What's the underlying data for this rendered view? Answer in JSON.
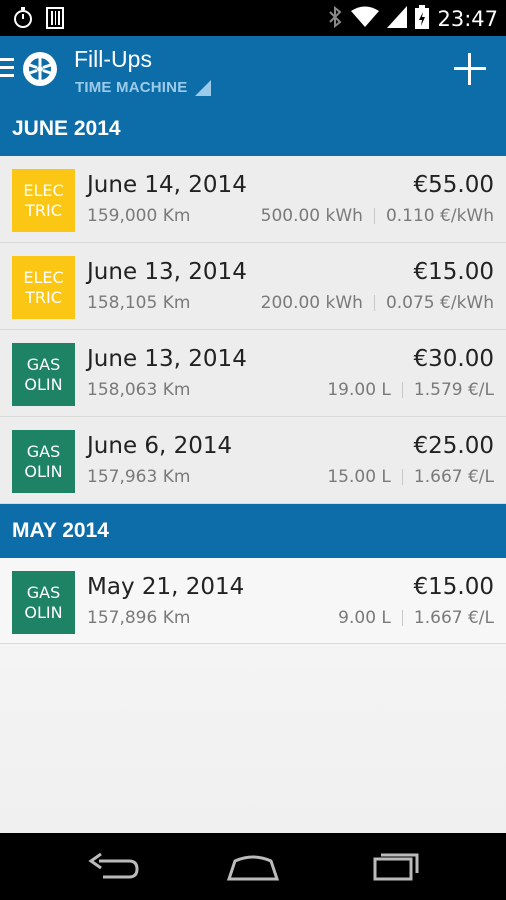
{
  "status_bar": {
    "time": "23:47",
    "left_icons": [
      "stopwatch-icon",
      "barcode-icon"
    ],
    "right_icons": [
      "bluetooth-icon",
      "wifi-icon",
      "signal-icon",
      "battery-icon"
    ]
  },
  "action_bar": {
    "title": "Fill-Ups",
    "subtitle": "TIME MACHINE",
    "color": "#0d6da8"
  },
  "sections": [
    {
      "header": "JUNE 2014",
      "items": [
        {
          "type_label": [
            "ELEC",
            "TRIC"
          ],
          "type": "electric",
          "date": "June 14, 2014",
          "odometer": "159,000 Km",
          "price": "€55.00",
          "quantity": "500.00 kWh",
          "unit_price": "0.110 €/kWh"
        },
        {
          "type_label": [
            "ELEC",
            "TRIC"
          ],
          "type": "electric",
          "date": "June 13, 2014",
          "odometer": "158,105 Km",
          "price": "€15.00",
          "quantity": "200.00 kWh",
          "unit_price": "0.075 €/kWh"
        },
        {
          "type_label": [
            "GAS",
            "OLIN"
          ],
          "type": "gasoline",
          "date": "June 13, 2014",
          "odometer": "158,063 Km",
          "price": "€30.00",
          "quantity": "19.00 L",
          "unit_price": "1.579 €/L"
        },
        {
          "type_label": [
            "GAS",
            "OLIN"
          ],
          "type": "gasoline",
          "date": "June 6, 2014",
          "odometer": "157,963 Km",
          "price": "€25.00",
          "quantity": "15.00 L",
          "unit_price": "1.667 €/L"
        }
      ]
    },
    {
      "header": "MAY 2014",
      "items": [
        {
          "type_label": [
            "GAS",
            "OLIN"
          ],
          "type": "gasoline",
          "date": "May 21, 2014",
          "odometer": "157,896 Km",
          "price": "€15.00",
          "quantity": "9.00 L",
          "unit_price": "1.667 €/L"
        }
      ]
    }
  ],
  "colors": {
    "electric": "#fcc614",
    "gasoline": "#1e8264",
    "header": "#0d6da8"
  },
  "nav_bar": {
    "icons": [
      "back-icon",
      "home-icon",
      "recent-apps-icon"
    ]
  }
}
